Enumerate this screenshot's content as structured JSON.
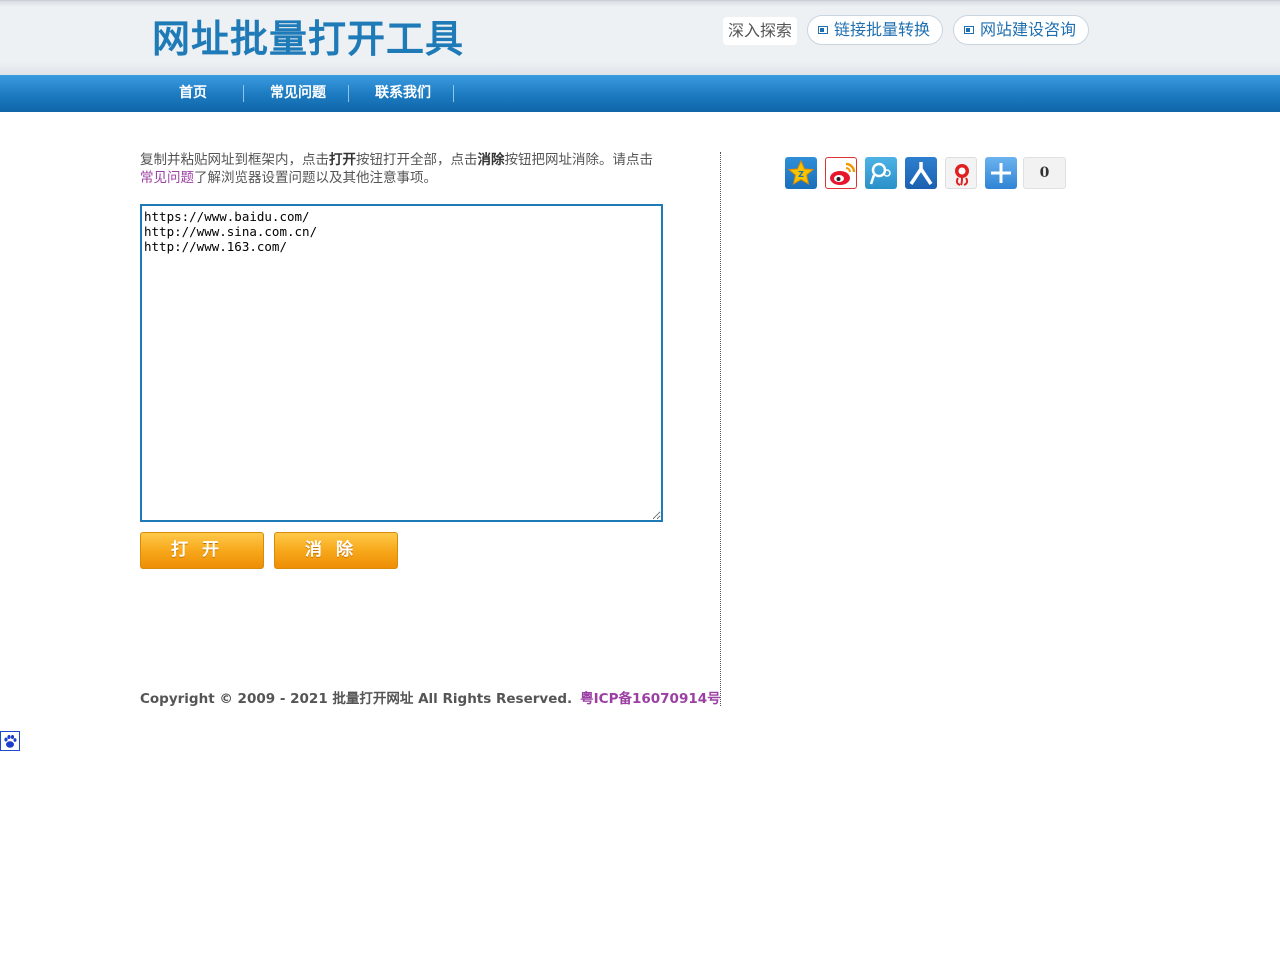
{
  "header": {
    "site_title": "网址批量打开工具",
    "search_tag": "深入探索",
    "links": [
      {
        "label": "链接批量转换"
      },
      {
        "label": "网站建设咨询"
      }
    ]
  },
  "nav": {
    "items": [
      {
        "label": "首页"
      },
      {
        "label": "常见问题"
      },
      {
        "label": "联系我们"
      }
    ]
  },
  "main": {
    "intro": {
      "part1": "复制并粘贴网址到框架内，点击",
      "open_bold": "打开",
      "part2": "按钮打开全部，点击",
      "clear_bold": "消除",
      "part3": "按钮把网址消除。请点击",
      "faq_link": "常见问题",
      "part4": "了解浏览器设置问题以及其他注意事项。"
    },
    "url_box_value": "https://www.baidu.com/\nhttp://www.sina.com.cn/\nhttp://www.163.com/",
    "open_button": "打开",
    "clear_button": "消除"
  },
  "footer": {
    "copyright": "Copyright © 2009 - 2021 批量打开网址 All Rights Reserved.",
    "icp": "粤ICP备16070914号"
  },
  "share": {
    "icons": [
      "qzone-icon",
      "weibo-icon",
      "tencent-weibo-icon",
      "renren-icon",
      "sohu-weibo-icon",
      "more-share-icon"
    ],
    "count": "0"
  },
  "colors": {
    "brand_blue": "#1f7bb8",
    "nav_blue": "#1f7dc4",
    "button_orange": "#f7a81b",
    "link_purple": "#9b3fa3"
  }
}
